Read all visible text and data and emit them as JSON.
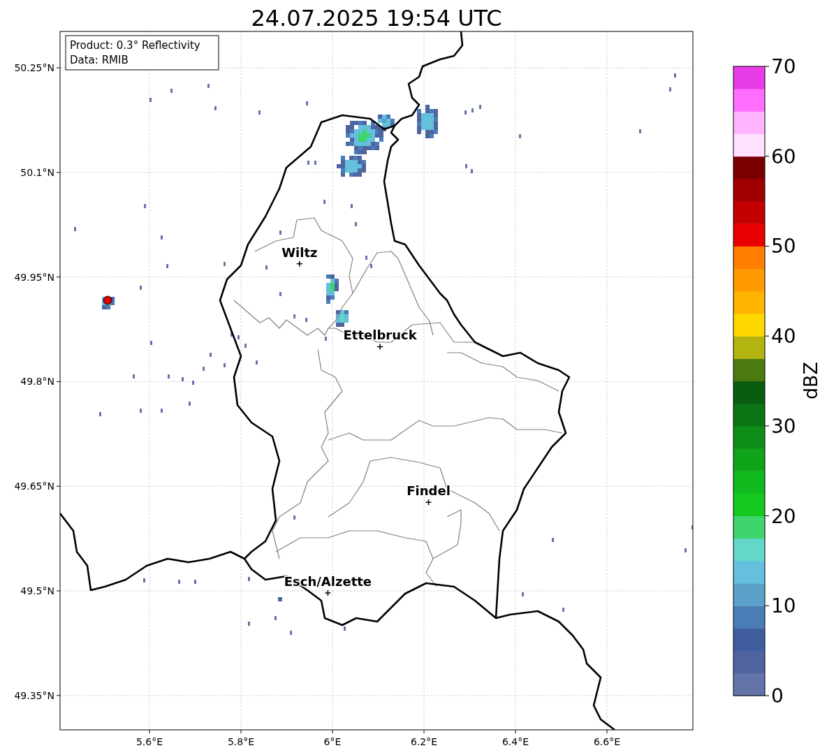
{
  "title": "24.07.2025 19:54 UTC",
  "annotation": [
    "Product: 0.3° Reflectivity",
    "Data: RMIB"
  ],
  "map": {
    "x_ticks": [
      "5.6°E",
      "5.8°E",
      "6°E",
      "6.2°E",
      "6.4°E",
      "6.6°E"
    ],
    "y_ticks": [
      "50.25°N",
      "50.1°N",
      "49.95°N",
      "49.8°N",
      "49.65°N",
      "49.5°N",
      "49.35°N"
    ],
    "cities": [
      "Wiltz",
      "Ettelbruck",
      "Findel",
      "Esch/Alzette"
    ]
  },
  "colorbar": {
    "label": "dBZ",
    "ticks": [
      "70",
      "60",
      "50",
      "40",
      "30",
      "20",
      "10",
      "0"
    ],
    "bins": [
      {
        "color": "#6374a8"
      },
      {
        "color": "#50649f"
      },
      {
        "color": "#405da0"
      },
      {
        "color": "#4a7db5"
      },
      {
        "color": "#5aa0c8"
      },
      {
        "color": "#64c0dc"
      },
      {
        "color": "#64d8c8"
      },
      {
        "color": "#3ed46e"
      },
      {
        "color": "#14c81e"
      },
      {
        "color": "#10b91e"
      },
      {
        "color": "#10a41a"
      },
      {
        "color": "#0e8c18"
      },
      {
        "color": "#0c7414"
      },
      {
        "color": "#0a5c10"
      },
      {
        "color": "#4a7a10"
      },
      {
        "color": "#b4b410"
      },
      {
        "color": "#ffd800"
      },
      {
        "color": "#ffb400"
      },
      {
        "color": "#ff9a00"
      },
      {
        "color": "#ff7e00"
      },
      {
        "color": "#e80000"
      },
      {
        "color": "#c40000"
      },
      {
        "color": "#a00000"
      },
      {
        "color": "#7a0000"
      },
      {
        "color": "#ffe0ff"
      },
      {
        "color": "#ffb4ff"
      },
      {
        "color": "#ff6eff"
      },
      {
        "color": "#e83ce8"
      }
    ]
  }
}
